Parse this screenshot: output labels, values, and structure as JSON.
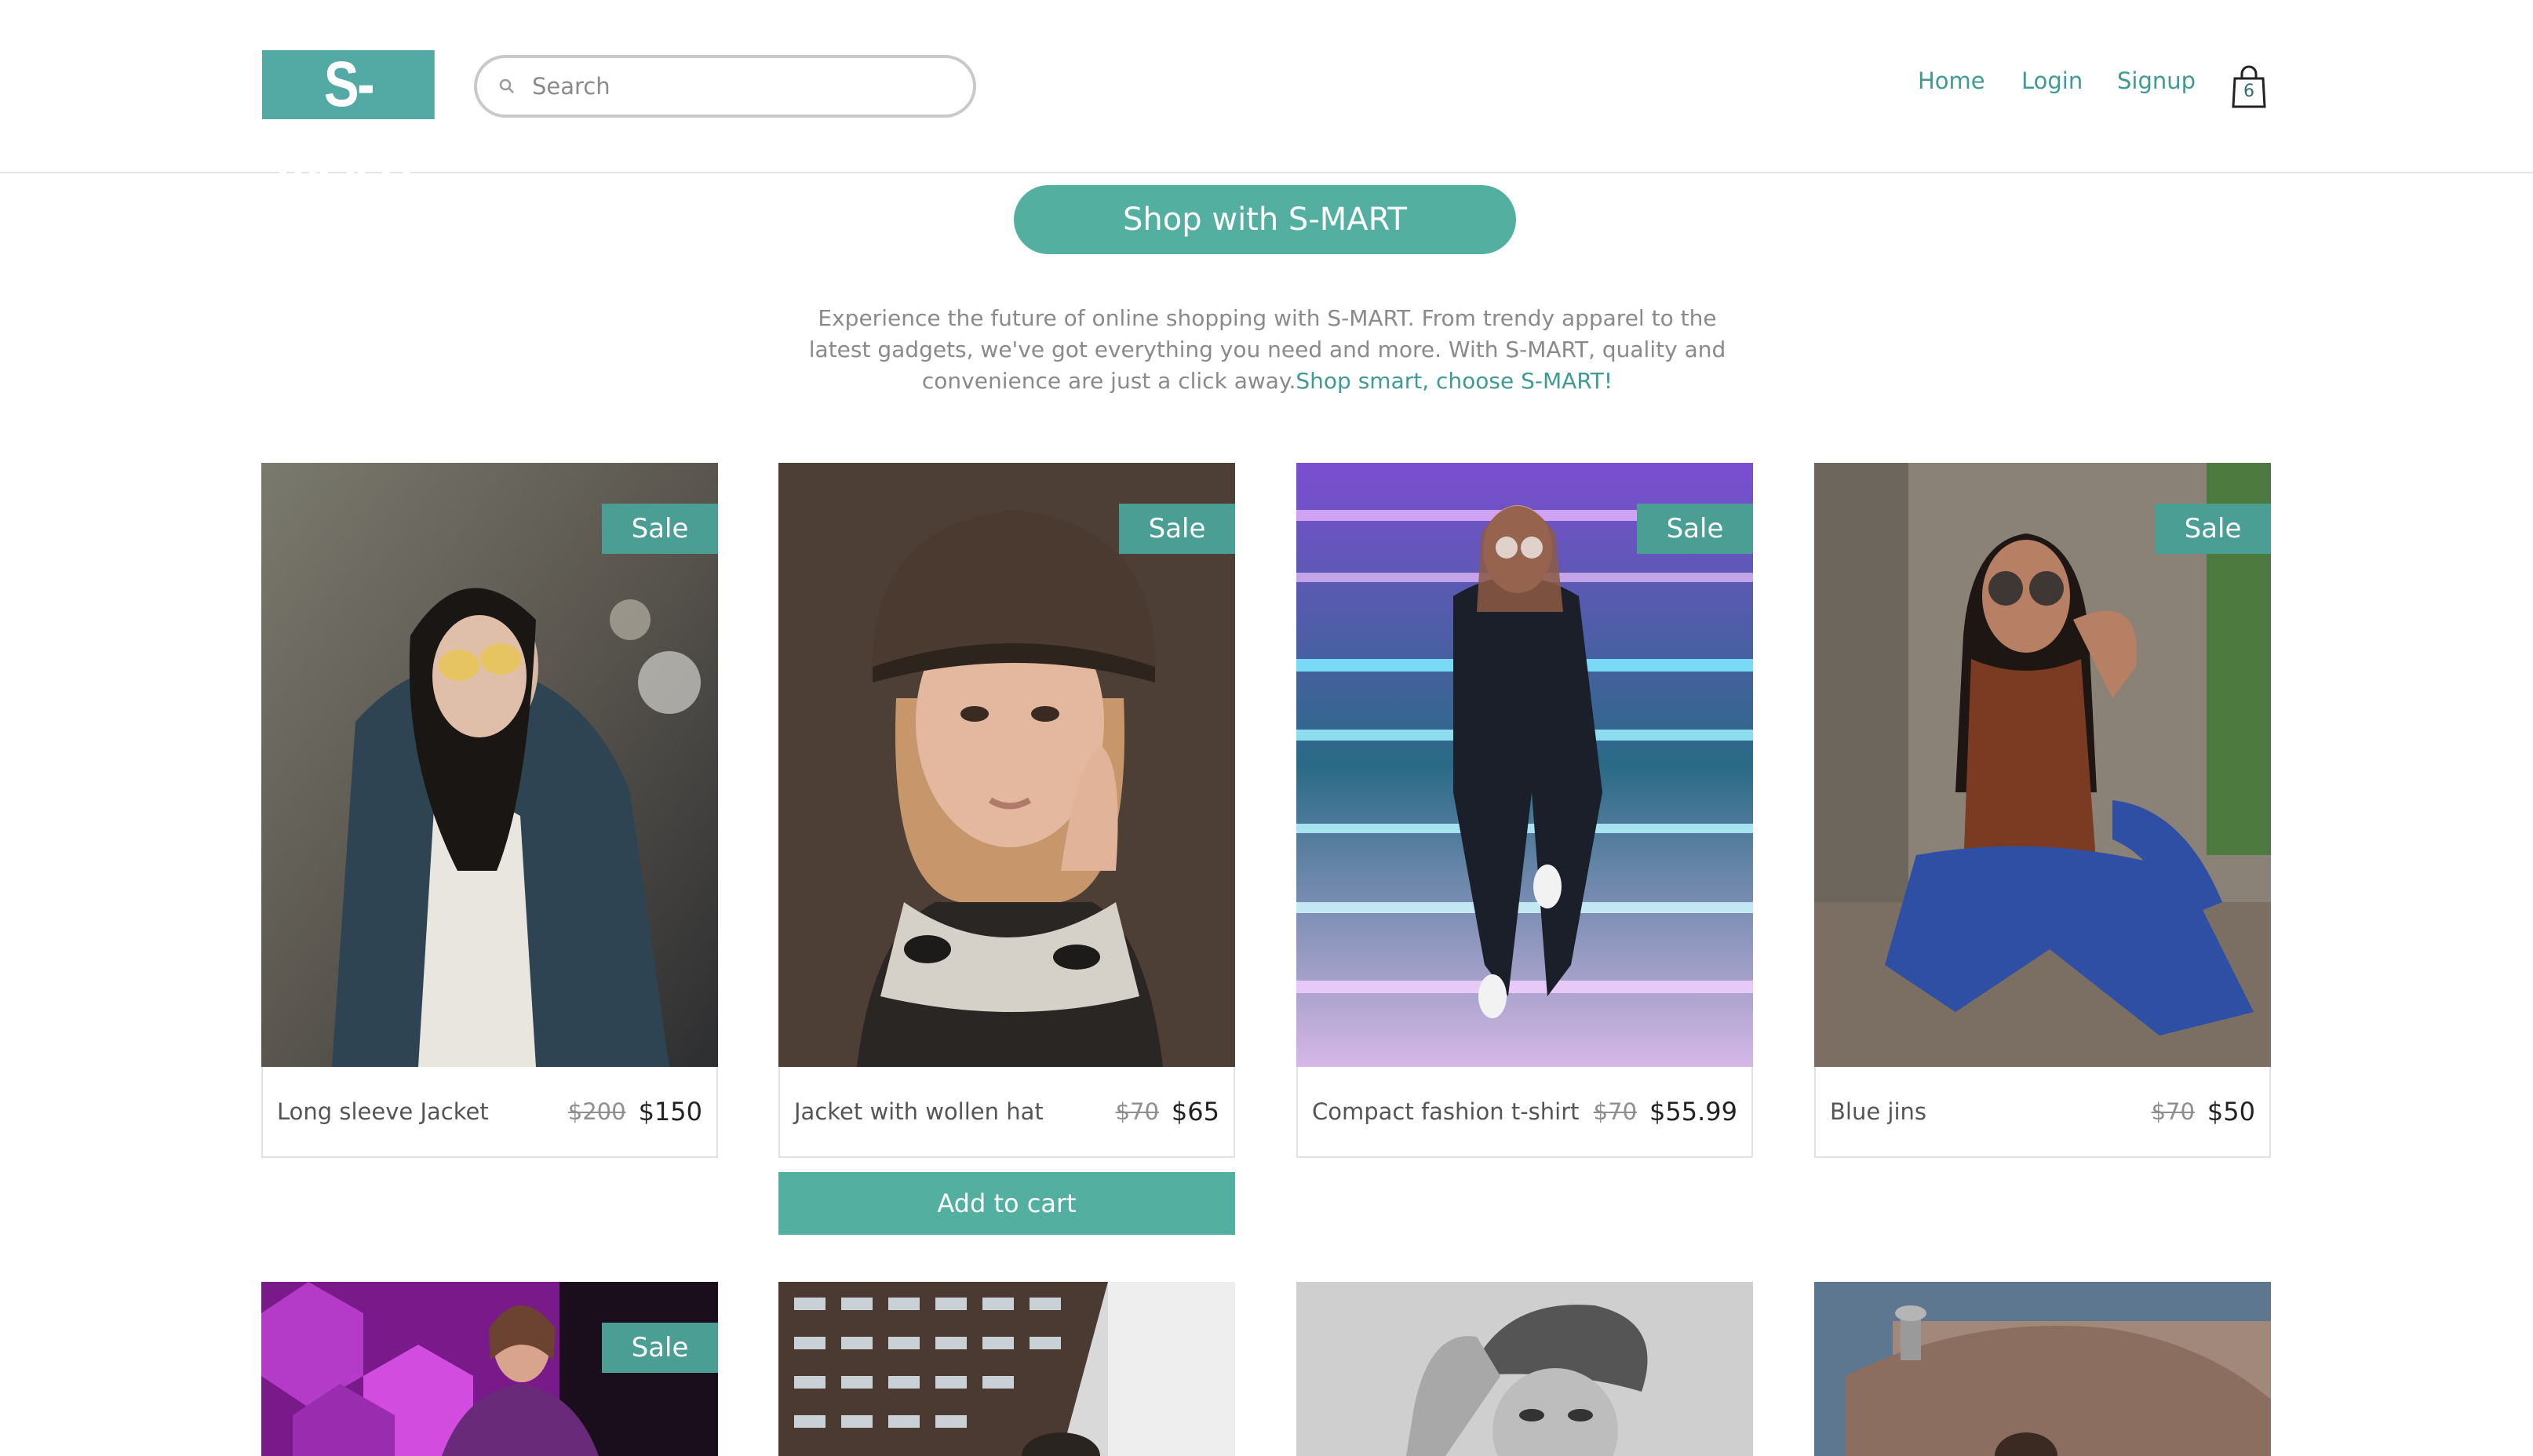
{
  "header": {
    "logo_text": "S-MART",
    "search_placeholder": "Search",
    "nav": {
      "home": "Home",
      "login": "Login",
      "signup": "Signup"
    },
    "cart_count": "6"
  },
  "hero": {
    "button_label": "Shop with S-MART",
    "description": "Experience the future of online shopping with S-MART. From trendy apparel to the latest gadgets, we've got everything you need and more. With S-MART, quality and convenience are just a click away.",
    "highlight": "Shop smart, choose S-MART!"
  },
  "colors": {
    "accent": "#53b0a0",
    "sale_badge": "#4a9e93",
    "nav_text": "#3f9a93"
  },
  "products": [
    {
      "name": "Long sleeve Jacket",
      "old_price": "$200",
      "price": "$150",
      "badge": "Sale"
    },
    {
      "name": "Jacket with wollen hat",
      "old_price": "$70",
      "price": "$65",
      "badge": "Sale",
      "add_to_cart": "Add to cart"
    },
    {
      "name": "Compact fashion t-shirt",
      "old_price": "$70",
      "price": "$55.99",
      "badge": "Sale"
    },
    {
      "name": "Blue jins",
      "old_price": "$70",
      "price": "$50",
      "badge": "Sale"
    },
    {
      "badge": "Sale"
    }
  ]
}
